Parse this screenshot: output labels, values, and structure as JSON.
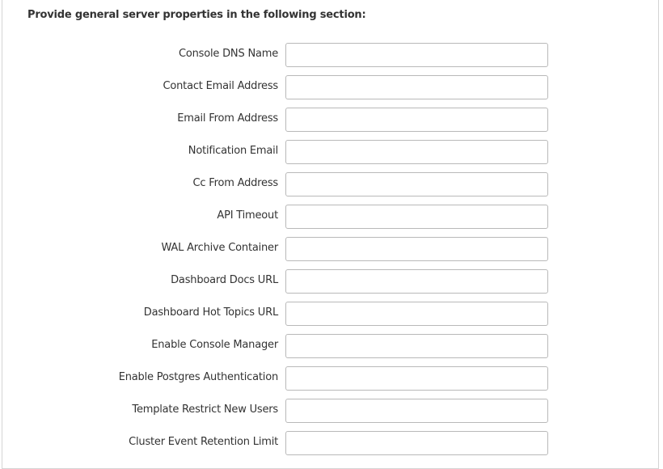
{
  "section": {
    "heading": "Provide general server properties in the following section:"
  },
  "fields": [
    {
      "label": "Console DNS Name",
      "value": "",
      "placeholder": ""
    },
    {
      "label": "Contact Email Address",
      "value": "",
      "placeholder": ""
    },
    {
      "label": "Email From Address",
      "value": "",
      "placeholder": ""
    },
    {
      "label": "Notification Email",
      "value": "",
      "placeholder": ""
    },
    {
      "label": "Cc From Address",
      "value": "",
      "placeholder": ""
    },
    {
      "label": "API Timeout",
      "value": "",
      "placeholder": ""
    },
    {
      "label": "WAL Archive Container",
      "value": "",
      "placeholder": ""
    },
    {
      "label": "Dashboard Docs URL",
      "value": "",
      "placeholder": ""
    },
    {
      "label": "Dashboard Hot Topics URL",
      "value": "",
      "placeholder": ""
    },
    {
      "label": "Enable Console Manager",
      "value": "",
      "placeholder": ""
    },
    {
      "label": "Enable Postgres Authentication",
      "value": "",
      "placeholder": ""
    },
    {
      "label": "Template Restrict New Users",
      "value": "",
      "placeholder": ""
    },
    {
      "label": "Cluster Event Retention Limit",
      "value": "",
      "placeholder": ""
    }
  ]
}
